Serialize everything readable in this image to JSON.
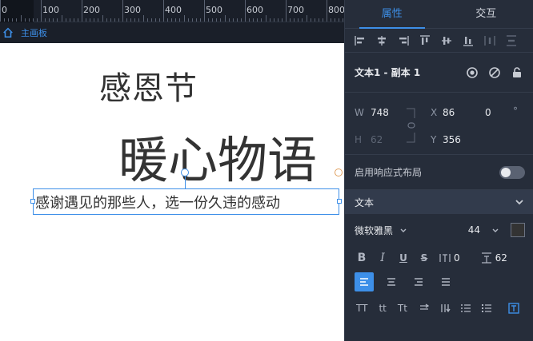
{
  "ruler": {
    "labels": [
      "0",
      "100",
      "200",
      "300",
      "400",
      "500",
      "600",
      "700",
      "800"
    ]
  },
  "breadcrumb": {
    "label": "主画板"
  },
  "canvas": {
    "text1": "感恩节",
    "text2": "暖心物语",
    "text3": "感谢遇见的那些人，选一份久违的感动"
  },
  "panel": {
    "tabs": [
      {
        "label": "属性"
      },
      {
        "label": "交互"
      }
    ],
    "layer": {
      "name": "文本1 - 副本 1"
    },
    "geometry": {
      "w_label": "W",
      "w_value": "748",
      "h_label": "H",
      "h_value": "62",
      "x_label": "X",
      "x_value": "86",
      "y_label": "Y",
      "y_value": "356",
      "rotation_value": "0",
      "rotation_unit": "°"
    },
    "responsive": {
      "label": "启用响应式布局"
    },
    "text_section": {
      "label": "文本"
    },
    "font": {
      "family": "微软雅黑",
      "size": "44"
    },
    "style": {
      "bold": "B",
      "italic": "I",
      "underline": "U",
      "strike": "S",
      "letter_spacing_value": "0",
      "line_height_value": "62"
    },
    "case": {
      "upper": "TT",
      "lower": "tt",
      "title": "Tt"
    }
  },
  "colors": {
    "accent": "#3d8fe8",
    "panel_bg": "#262d3a",
    "canvas_bg": "#ffffff"
  }
}
